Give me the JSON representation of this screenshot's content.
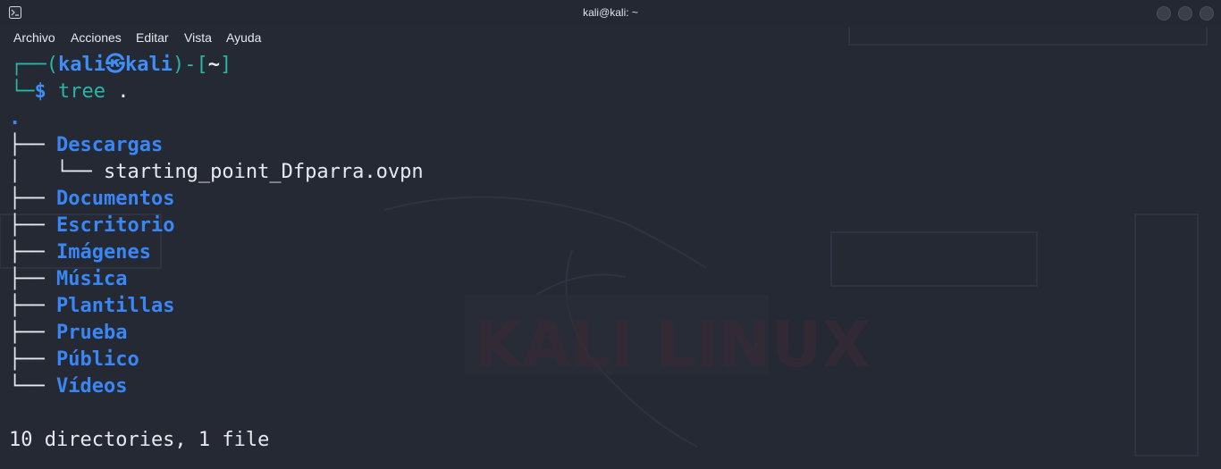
{
  "window": {
    "title": "kali@kali: ~",
    "icon": "terminal-icon"
  },
  "menu": {
    "items": [
      "Archivo",
      "Acciones",
      "Editar",
      "Vista",
      "Ayuda"
    ]
  },
  "prompt": {
    "open": "┌──(",
    "user": "kali",
    "at_symbol": "㉿",
    "host": "kali",
    "mid": ")-[",
    "cwd": "~",
    "close": "]",
    "line2_prefix": "└─",
    "dollar": "$",
    "command": "tree",
    "argument": "."
  },
  "tree": {
    "root": ".",
    "entries": [
      {
        "branch": "├── ",
        "name": "Descargas",
        "type": "dir"
      },
      {
        "branch": "│   └── ",
        "name": "starting_point_Dfparra.ovpn",
        "type": "file"
      },
      {
        "branch": "├── ",
        "name": "Documentos",
        "type": "dir"
      },
      {
        "branch": "├── ",
        "name": "Escritorio",
        "type": "dir"
      },
      {
        "branch": "├── ",
        "name": "Imágenes",
        "type": "dir"
      },
      {
        "branch": "├── ",
        "name": "Música",
        "type": "dir"
      },
      {
        "branch": "├── ",
        "name": "Plantillas",
        "type": "dir"
      },
      {
        "branch": "├── ",
        "name": "Prueba",
        "type": "dir"
      },
      {
        "branch": "├── ",
        "name": "Público",
        "type": "dir"
      },
      {
        "branch": "└── ",
        "name": "Vídeos",
        "type": "dir"
      }
    ],
    "summary": "10 directories, 1 file"
  },
  "colors": {
    "background": "#242934",
    "prompt_teal": "#2bb5a7",
    "directory_blue": "#3a86f5",
    "text": "#e7e9ee"
  }
}
